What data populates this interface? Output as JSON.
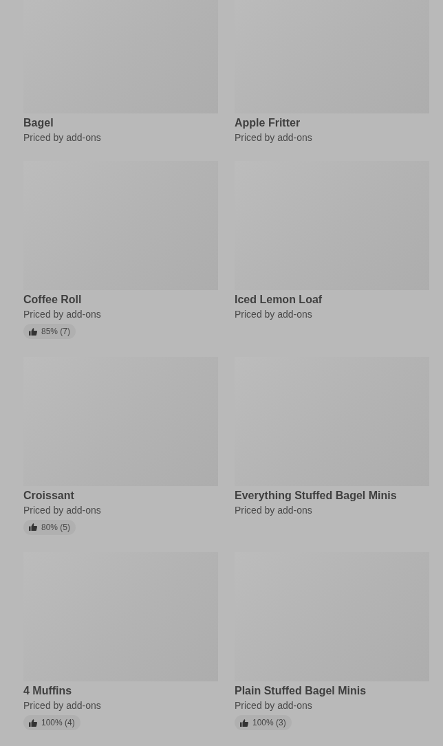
{
  "items": [
    {
      "name": "Bagel",
      "subtitle": "Priced by add-ons"
    },
    {
      "name": "Apple Fritter",
      "subtitle": "Priced by add-ons"
    },
    {
      "name": "Coffee Roll",
      "subtitle": "Priced by add-ons",
      "rating": "85% (7)"
    },
    {
      "name": "Iced Lemon Loaf",
      "subtitle": "Priced by add-ons"
    },
    {
      "name": "Croissant",
      "subtitle": "Priced by add-ons",
      "rating": "80% (5)"
    },
    {
      "name": "Everything Stuffed Bagel Minis",
      "subtitle": "Priced by add-ons"
    },
    {
      "name": "4 Muffins",
      "subtitle": "Priced by add-ons",
      "rating": "100% (4)"
    },
    {
      "name": "Plain Stuffed Bagel Minis",
      "subtitle": "Priced by add-ons",
      "rating": "100% (3)"
    }
  ]
}
